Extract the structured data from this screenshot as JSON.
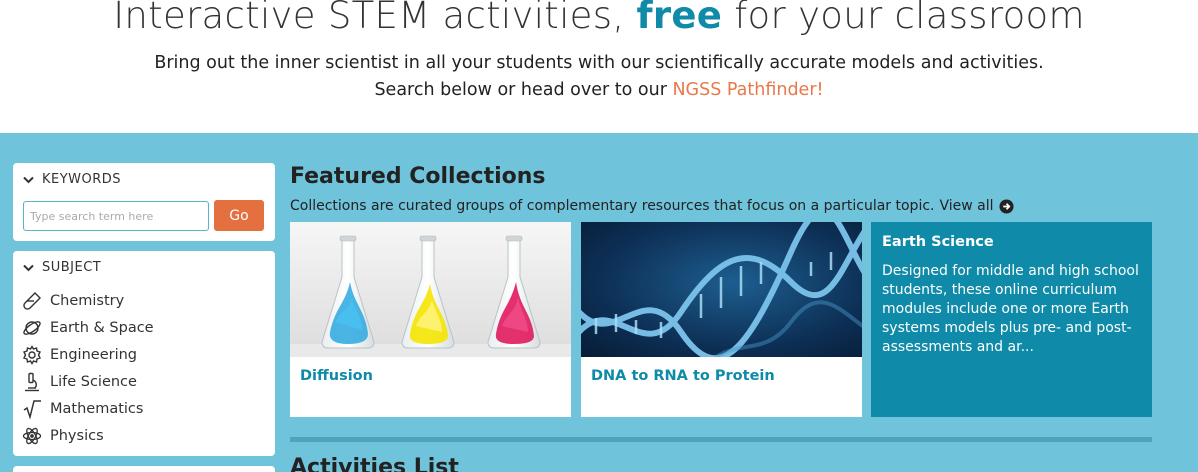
{
  "hero": {
    "title_pre": "Interactive STEM activities, ",
    "title_highlight": "free",
    "title_post": " for your classroom",
    "subtitle_line1": "Bring out the inner scientist in all your students with our scientifically accurate models and activities.",
    "subtitle_line2_prefix": "Search below or head over to our ",
    "subtitle_link": "NGSS Pathfinder!"
  },
  "filters": {
    "keywords": {
      "heading": "KEYWORDS",
      "placeholder": "Type search term here",
      "value": "",
      "go_label": "Go"
    },
    "subject": {
      "heading": "SUBJECT",
      "items": [
        {
          "label": "Chemistry",
          "icon": "test-tube-icon"
        },
        {
          "label": "Earth & Space",
          "icon": "planet-icon"
        },
        {
          "label": "Engineering",
          "icon": "gear-icon"
        },
        {
          "label": "Life Science",
          "icon": "microscope-icon"
        },
        {
          "label": "Mathematics",
          "icon": "square-root-icon"
        },
        {
          "label": "Physics",
          "icon": "atom-icon"
        }
      ]
    }
  },
  "featured": {
    "title": "Featured Collections",
    "description": "Collections are curated groups of complementary resources that focus on a particular topic.",
    "view_all": "View all",
    "cards": [
      {
        "label": "Diffusion"
      },
      {
        "label": "DNA to RNA to Protein"
      },
      {
        "title": "Earth Science",
        "description": "Designed for middle and high school students, these online curriculum modules include one or more Earth systems models plus pre- and post-assessments and ar..."
      }
    ]
  },
  "activities": {
    "title": "Activities List"
  },
  "colors": {
    "accent": "#0f8aa8",
    "band": "#6fc3da",
    "button": "#e5703f",
    "link": "#e8784a"
  }
}
